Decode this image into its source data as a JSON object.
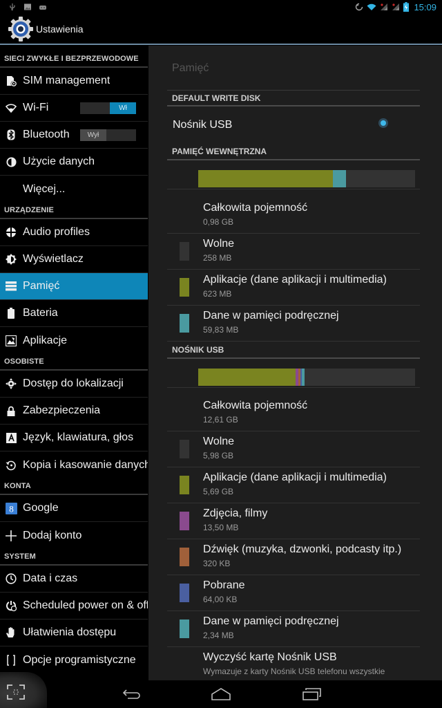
{
  "status_bar": {
    "left_icons": [
      "usb-icon",
      "image-icon",
      "android-debug-icon"
    ],
    "right_icons": [
      "sync-icon",
      "wifi-icon",
      "signal-sim1-icon",
      "signal-sim2-icon",
      "battery-charging-icon"
    ],
    "time": "15:09",
    "accent_color": "#33b5e5"
  },
  "action_bar": {
    "icon": "settings-gear-icon",
    "title": "Ustawienia"
  },
  "sidebar": {
    "sections": [
      {
        "header": "SIECI ZWYKŁE I BEZPRZEWODOWE",
        "items": [
          {
            "label": "SIM management",
            "icon": "sim-management-icon"
          },
          {
            "label": "Wi-Fi",
            "icon": "wifi-icon",
            "toggle": {
              "state": "on",
              "label": "Wł"
            }
          },
          {
            "label": "Bluetooth",
            "icon": "bluetooth-icon",
            "toggle": {
              "state": "off",
              "label": "Wył"
            }
          },
          {
            "label": "Użycie danych",
            "icon": "data-usage-icon"
          },
          {
            "label": "Więcej...",
            "icon": null
          }
        ]
      },
      {
        "header": "URZĄDZENIE",
        "items": [
          {
            "label": "Audio profiles",
            "icon": "audio-profiles-icon"
          },
          {
            "label": "Wyświetlacz",
            "icon": "display-icon"
          },
          {
            "label": "Pamięć",
            "icon": "storage-icon",
            "active": true
          },
          {
            "label": "Bateria",
            "icon": "battery-icon"
          },
          {
            "label": "Aplikacje",
            "icon": "apps-icon"
          }
        ]
      },
      {
        "header": "OSOBISTE",
        "items": [
          {
            "label": "Dostęp do lokalizacji",
            "icon": "location-icon"
          },
          {
            "label": "Zabezpieczenia",
            "icon": "lock-icon"
          },
          {
            "label": "Język, klawiatura, głos",
            "icon": "language-icon"
          },
          {
            "label": "Kopia i kasowanie danych",
            "icon": "backup-reset-icon"
          }
        ]
      },
      {
        "header": "KONTA",
        "items": [
          {
            "label": "Google",
            "icon": "google-icon"
          },
          {
            "label": "Dodaj konto",
            "icon": "plus-icon"
          }
        ]
      },
      {
        "header": "SYSTEM",
        "items": [
          {
            "label": "Data i czas",
            "icon": "clock-icon"
          },
          {
            "label": "Scheduled power on & off",
            "icon": "scheduled-power-icon"
          },
          {
            "label": "Ułatwienia dostępu",
            "icon": "accessibility-hand-icon"
          },
          {
            "label": "Opcje programistyczne",
            "icon": "developer-braces-icon"
          }
        ]
      }
    ],
    "active_color": "#0e86b8"
  },
  "pane": {
    "title": "Pamięć",
    "default_write_disk": {
      "header": "DEFAULT WRITE DISK",
      "option_label": "Nośnik USB",
      "selected": true
    },
    "internal": {
      "header": "PAMIĘĆ WEWNĘTRZNA",
      "usage_fractions": [
        {
          "name": "Aplikacje",
          "fraction": 0.62,
          "color": "#7a8420"
        },
        {
          "name": "Dane w pamięci podręcznej",
          "fraction": 0.06,
          "color": "#4a9aa0"
        }
      ],
      "rows": [
        {
          "title": "Całkowita pojemność",
          "value": "0,98 GB",
          "color": null
        },
        {
          "title": "Wolne",
          "value": "258 MB",
          "color": "#333333"
        },
        {
          "title": "Aplikacje (dane aplikacji i multimedia)",
          "value": "623 MB",
          "color": "#7a8420"
        },
        {
          "title": "Dane w pamięci podręcznej",
          "value": "59,83 MB",
          "color": "#4a9aa0"
        }
      ]
    },
    "usb": {
      "header": "NOŚNIK USB",
      "usage_fractions": [
        {
          "name": "Aplikacje",
          "fraction": 0.45,
          "color": "#7a8420"
        },
        {
          "name": "Zdjęcia, filmy",
          "fraction": 0.013,
          "color": "#8a4a8e"
        },
        {
          "name": "Dźwięk",
          "fraction": 0.008,
          "color": "#a0603a"
        },
        {
          "name": "Pobrane",
          "fraction": 0.008,
          "color": "#4a5fa0"
        },
        {
          "name": "Dane w pamięci podręcznej",
          "fraction": 0.012,
          "color": "#4a9aa0"
        }
      ],
      "rows": [
        {
          "title": "Całkowita pojemność",
          "value": "12,61 GB",
          "color": null
        },
        {
          "title": "Wolne",
          "value": "5,98 GB",
          "color": "#333333"
        },
        {
          "title": "Aplikacje (dane aplikacji i multimedia)",
          "value": "5,69 GB",
          "color": "#7a8420"
        },
        {
          "title": "Zdjęcia, filmy",
          "value": "13,50 MB",
          "color": "#8a4a8e"
        },
        {
          "title": "Dźwięk (muzyka, dzwonki, podcasty itp.)",
          "value": "320 KB",
          "color": "#a0603a"
        },
        {
          "title": "Pobrane",
          "value": "64,00 KB",
          "color": "#4a5fa0"
        },
        {
          "title": "Dane w pamięci podręcznej",
          "value": "2,34 MB",
          "color": "#4a9aa0"
        }
      ],
      "erase": {
        "title": "Wyczyść kartę Nośnik USB",
        "subtitle": "Wymazuje z karty Nośnik USB telefonu wszystkie"
      }
    }
  },
  "nav_bar": {
    "buttons": [
      "screenshot-icon",
      "back-icon",
      "home-icon",
      "recent-apps-icon"
    ]
  }
}
